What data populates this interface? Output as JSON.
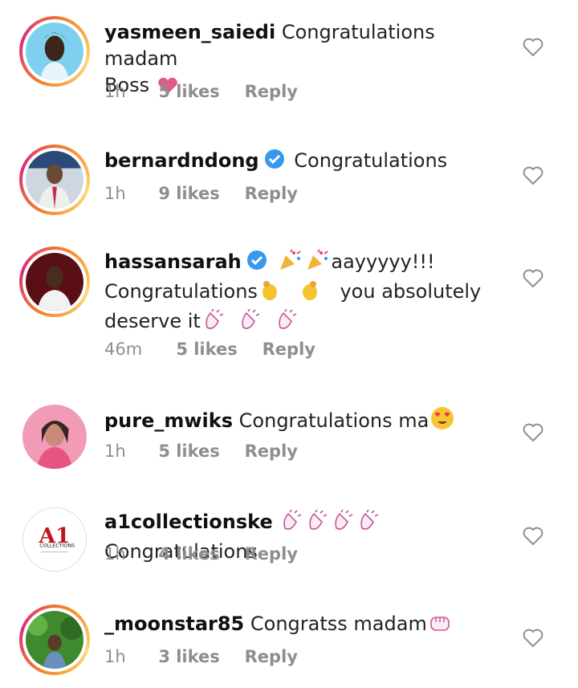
{
  "comments": [
    {
      "username": "yasmeen_saiedi",
      "verified": false,
      "text1": "Congratulations madam",
      "text2": "Boss",
      "time": "1h",
      "likes": "5 likes",
      "reply": "Reply"
    },
    {
      "username": "bernardndong",
      "verified": true,
      "text1": "Congratulations",
      "time": "1h",
      "likes": "9 likes",
      "reply": "Reply"
    },
    {
      "username": "hassansarah",
      "verified": true,
      "text1": "aayyyyy!!!",
      "text2a": "Congratulations",
      "text2b": "you absolutely",
      "text3": "deserve it",
      "time": "46m",
      "likes": "5 likes",
      "reply": "Reply"
    },
    {
      "username": "pure_mwiks",
      "verified": false,
      "text1": "Congratulations ma",
      "time": "1h",
      "likes": "5 likes",
      "reply": "Reply"
    },
    {
      "username": "a1collectionske",
      "verified": false,
      "text1": "Congratulations",
      "time": "1h",
      "likes": "4 likes",
      "reply": "Reply",
      "avatar_text": "A1",
      "avatar_sub": "COLLECTIONS"
    },
    {
      "username": "_moonstar85",
      "verified": false,
      "text1": "Congratss madam",
      "time": "1h",
      "likes": "3 likes",
      "reply": "Reply"
    }
  ],
  "colors": {
    "verified": "#3897f0",
    "meta": "#8e8e8e",
    "ring": "#dd2a7b"
  },
  "icons": {
    "like": "heart-outline-icon",
    "verified": "verified-badge-icon"
  }
}
